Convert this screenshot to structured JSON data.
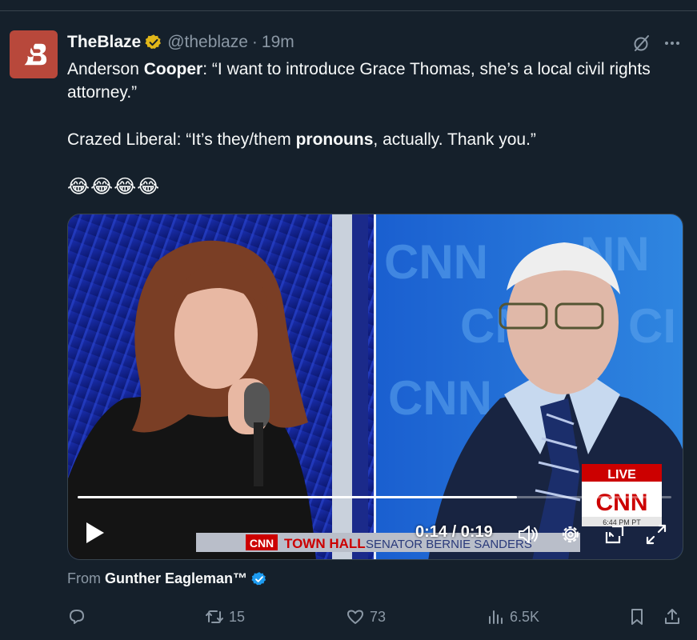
{
  "post": {
    "author_name": "TheBlaze",
    "author_handle": "@theblaze",
    "separator": "·",
    "timestamp": "19m",
    "text_prefix_1": "Anderson ",
    "text_bold_1": "Cooper",
    "text_rest_1": ": “I want to introduce Grace Thomas, she’s a local civil rights attorney.”",
    "text_prefix_2": "Crazed Liberal: “It’s they/them ",
    "text_bold_2": "pronouns",
    "text_rest_2": ", actually. Thank you.”",
    "emojis": "😂😂😂😂"
  },
  "video": {
    "timecode": "0:14 / 0:19",
    "progress_fraction": 0.74,
    "live_label": "LIVE",
    "cnn_logo": "CNN",
    "broadcast_time": "6:44 PM PT",
    "lower_third_logo": "CNN",
    "lower_third_text": "TOWN HALL",
    "lower_third_subtext": "SENATOR BERNIE SANDERS"
  },
  "source": {
    "from_label": "From",
    "name": "Gunther Eagleman™"
  },
  "actions": {
    "reposts": "15",
    "likes": "73",
    "views": "6.5K"
  },
  "colors": {
    "background": "#15202b",
    "muted": "#8b98a5",
    "verified_gold": "#e2b719",
    "verified_blue": "#1d9bf0",
    "avatar_bg": "#b8483b"
  }
}
